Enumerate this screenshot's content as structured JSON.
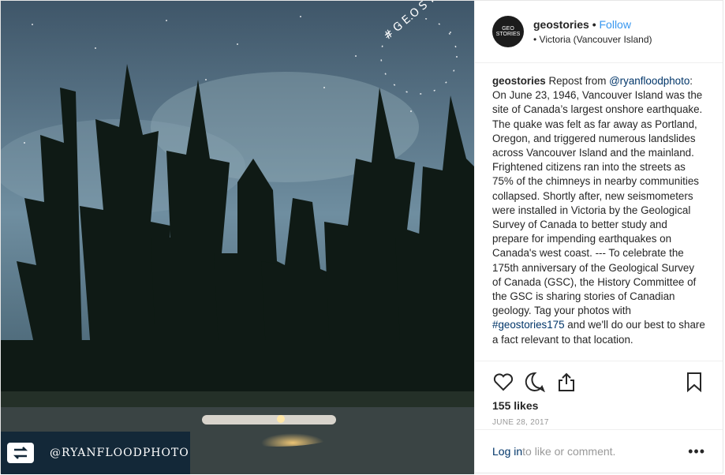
{
  "photo": {
    "credit": "@RYANFLOODPHOTO",
    "watermark": "#GEOSTORIES"
  },
  "profile": {
    "avatar_text_1": "GEO",
    "avatar_text_2": "STORIES",
    "username": "geostories",
    "separator": "•",
    "follow": "Follow",
    "location": "• Victoria (Vancouver Island)"
  },
  "caption": {
    "user": "geostories",
    "intro": " Repost from ",
    "mention": "@ryanfloodphoto",
    "body": ": On June 23, 1946, Vancouver Island was the site of Canada’s largest onshore earthquake. The quake was felt as far away as Portland, Oregon, and triggered numerous landslides across Vancouver Island and the mainland. Frightened citizens ran into the streets as 75% of the chimneys in nearby communities collapsed. Shortly after, new seismometers were installed in Victoria by the Geological Survey of Canada to better study and prepare for impending earthquakes on Canada's west coast. --- To celebrate the 175th anniversary of the Geological Survey of Canada (GSC), the History Committee of the GSC is sharing stories of Canadian geology. Tag your photos with ",
    "hashtag": "#geostories175",
    "tail": " and we'll do our best to share a fact relevant to that location."
  },
  "actions": {
    "like_icon": "heart-icon",
    "comment_icon": "comment-icon",
    "share_icon": "share-icon",
    "save_icon": "bookmark-icon"
  },
  "likes": "155 likes",
  "date": "JUNE 28, 2017",
  "footer": {
    "login": "Log in",
    "rest": " to like or comment.",
    "more": "•••"
  }
}
